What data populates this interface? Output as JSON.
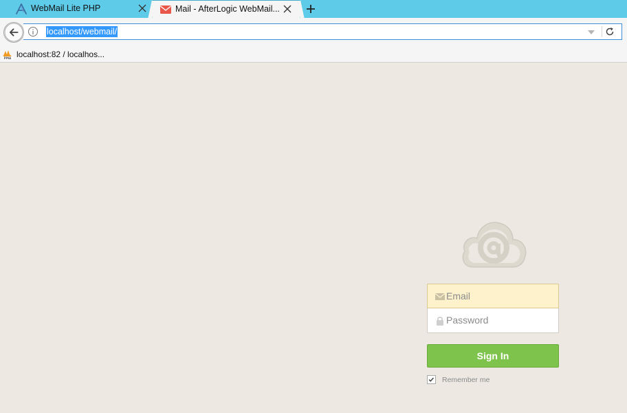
{
  "browser": {
    "tabs": [
      {
        "title": "WebMail Lite PHP",
        "icon": "afterlogic-a-icon",
        "active": false
      },
      {
        "title": "Mail - AfterLogic WebMail...",
        "icon": "mail-envelope-icon",
        "active": true
      }
    ],
    "address": {
      "url": "localhost/webmail/"
    },
    "bookmarks": [
      {
        "label": "localhost:82 / localhos...",
        "icon": "phpmyadmin-icon"
      }
    ]
  },
  "login": {
    "email_placeholder": "Email",
    "password_placeholder": "Password",
    "signin_label": "Sign In",
    "remember_label": "Remember me",
    "remember_checked": true
  },
  "colors": {
    "tabstrip": "#5ecbe9",
    "page_background": "#ede9e2",
    "signin_button": "#7ec34b",
    "email_field_autofill": "#fdf2cc",
    "url_selection": "#3399ff"
  }
}
